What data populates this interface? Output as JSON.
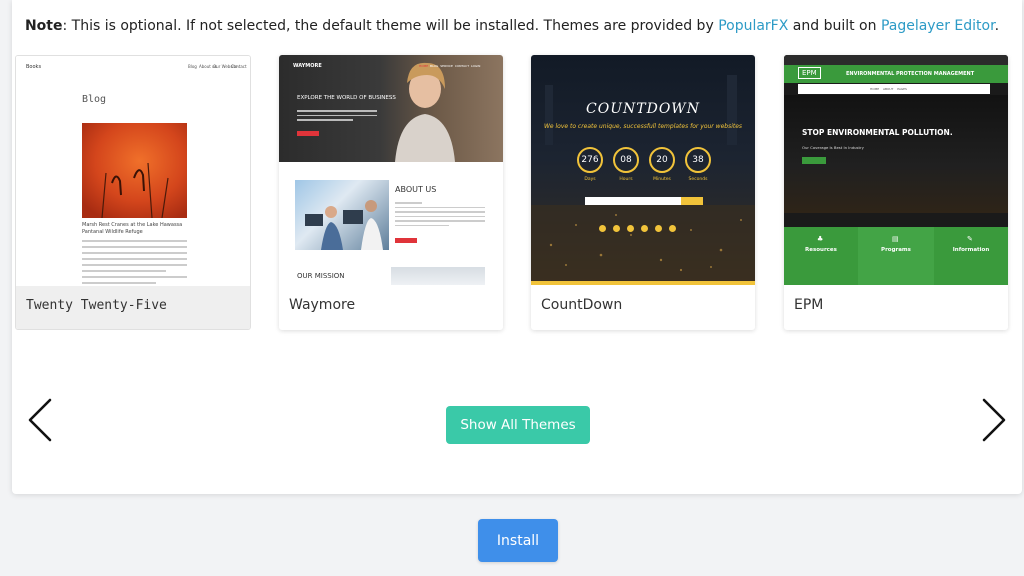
{
  "note": {
    "label": "Note",
    "text_1": ": This is optional. If not selected, the default theme will be installed. Themes are provided by ",
    "link_1": "PopularFX",
    "text_2": " and built on ",
    "link_2": "Pagelayer Editor",
    "text_3": "."
  },
  "colors": {
    "link": "#2d9bc6",
    "show_all_bg": "#3ac9a8",
    "install_bg": "#3f8fea"
  },
  "themes": [
    {
      "name": "Twenty Twenty-Five",
      "preview": {
        "site": "Books",
        "nav": [
          "Blog",
          "About us",
          "Our Website",
          "Contact"
        ],
        "heading": "Blog",
        "post_title": "Marsh Rest Cranes at the Lake Hawassa Pantanal Wildlife Refuge"
      }
    },
    {
      "name": "Waymore",
      "preview": {
        "brand": "WAYMORE",
        "nav": [
          "HOME",
          "BLOG",
          "SERVICE",
          "CONTACT",
          "LOGIN"
        ],
        "hero": "EXPLORE THE WORLD OF BUSINESS",
        "about": "ABOUT US",
        "mission": "OUR MISSION"
      }
    },
    {
      "name": "CountDown",
      "preview": {
        "title": "COUNTDOWN",
        "tagline": "We love to create unique, successfull templates for your websites",
        "timer": [
          {
            "value": "276",
            "unit": "Days"
          },
          {
            "value": "08",
            "unit": "Hours"
          },
          {
            "value": "20",
            "unit": "Minutes"
          },
          {
            "value": "38",
            "unit": "Seconds"
          }
        ]
      }
    },
    {
      "name": "EPM",
      "preview": {
        "logo": "EPM",
        "org": "ENVIRONMENTAL PROTECTION MANAGEMENT",
        "nav": [
          "HOME",
          "ABOUT",
          "PAGES"
        ],
        "headline": "STOP ENVIRONMENTAL POLLUTION.",
        "subline": "Our Coverage Is Best In Industry",
        "columns": [
          "Resources",
          "Programs",
          "Information"
        ]
      }
    }
  ],
  "show_all_label": "Show All Themes",
  "install_label": "Install"
}
